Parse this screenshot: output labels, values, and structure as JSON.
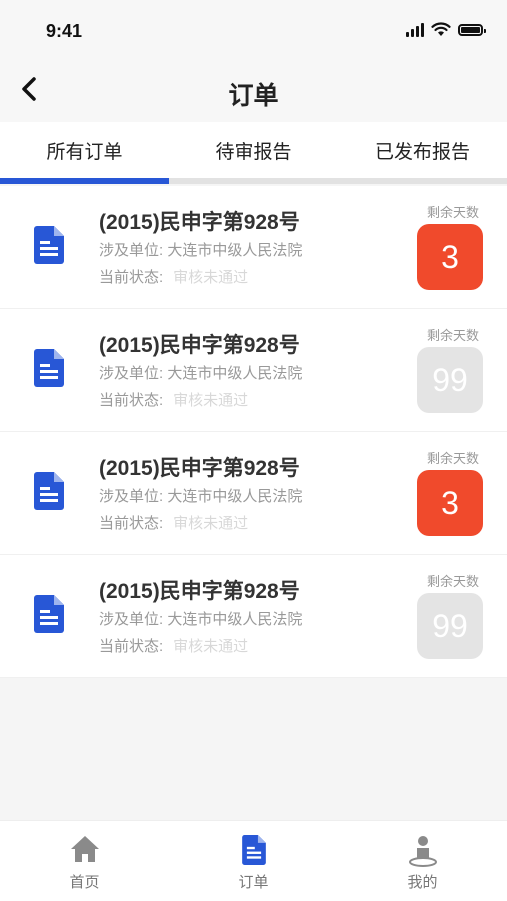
{
  "status_bar": {
    "time": "9:41"
  },
  "header": {
    "title": "订单"
  },
  "tabs": [
    {
      "label": "所有订单",
      "active": true
    },
    {
      "label": "待审报告",
      "active": false
    },
    {
      "label": "已发布报告",
      "active": false
    }
  ],
  "orders": [
    {
      "title": "(2015)民申字第928号",
      "unit_label": "涉及单位:",
      "unit": "大连市中级人民法院",
      "state_label": "当前状态:",
      "state": "审核未通过",
      "remain_label": "剩余天数",
      "days": "3",
      "urgent": true
    },
    {
      "title": "(2015)民申字第928号",
      "unit_label": "涉及单位:",
      "unit": "大连市中级人民法院",
      "state_label": "当前状态:",
      "state": "审核未通过",
      "remain_label": "剩余天数",
      "days": "99",
      "urgent": false
    },
    {
      "title": "(2015)民申字第928号",
      "unit_label": "涉及单位:",
      "unit": "大连市中级人民法院",
      "state_label": "当前状态:",
      "state": "审核未通过",
      "remain_label": "剩余天数",
      "days": "3",
      "urgent": true
    },
    {
      "title": "(2015)民申字第928号",
      "unit_label": "涉及单位:",
      "unit": "大连市中级人民法院",
      "state_label": "当前状态:",
      "state": "审核未通过",
      "remain_label": "剩余天数",
      "days": "99",
      "urgent": false
    }
  ],
  "bottom_nav": [
    {
      "label": "首页",
      "icon": "home-icon",
      "active": false
    },
    {
      "label": "订单",
      "icon": "document-icon",
      "active": true
    },
    {
      "label": "我的",
      "icon": "user-icon",
      "active": false
    }
  ],
  "colors": {
    "primary": "#2857d6",
    "urgent": "#f04a2c",
    "inactive_badge": "#e4e4e4",
    "inactive_icon": "#8a8a8a"
  }
}
